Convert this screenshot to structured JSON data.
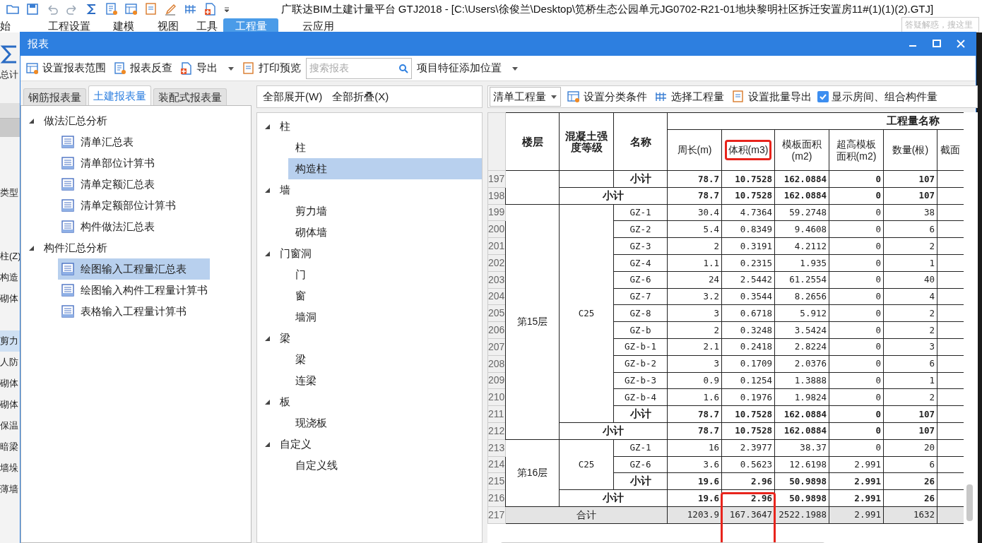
{
  "app": {
    "title": "广联达BIM土建计量平台 GTJ2018 - [C:\\Users\\徐俊兰\\Desktop\\笕桥生态公园单元JG0702-R21-01地块黎明社区拆迁安置房11#(1)(1)(2).GTJ]",
    "menu": [
      {
        "label": "始",
        "selected": false
      },
      {
        "label": "工程设置",
        "selected": false
      },
      {
        "label": "建模",
        "selected": false
      },
      {
        "label": "视图",
        "selected": false
      },
      {
        "label": "工具",
        "selected": false
      },
      {
        "label": "工程量",
        "selected": true
      },
      {
        "label": "云应用",
        "selected": false
      }
    ],
    "help_placeholder": "答疑解惑，搜这里",
    "side_label": "总计",
    "side_groups": [
      [
        {
          "label": "类型",
          "selected": false
        }
      ],
      [
        {
          "label": "柱(Z)",
          "selected": false
        },
        {
          "label": "构造",
          "selected": false
        },
        {
          "label": "砌体",
          "selected": false
        }
      ],
      [
        {
          "label": "剪力",
          "selected": true
        },
        {
          "label": "人防",
          "selected": false
        },
        {
          "label": "砌体",
          "selected": false
        },
        {
          "label": "砌体",
          "selected": false
        },
        {
          "label": "保温",
          "selected": false
        },
        {
          "label": "暗梁",
          "selected": false
        },
        {
          "label": "墙垛",
          "selected": false
        },
        {
          "label": "薄墙",
          "selected": false
        }
      ]
    ]
  },
  "dialog": {
    "title": "报表",
    "toolbar": [
      {
        "kind": "button",
        "label": "设置报表范围"
      },
      {
        "kind": "button",
        "label": "报表反查"
      },
      {
        "kind": "menu",
        "label": "导出"
      },
      {
        "kind": "button",
        "label": "打印预览"
      },
      {
        "kind": "search",
        "placeholder": "搜索报表"
      },
      {
        "kind": "menu",
        "label": "项目特征添加位置"
      }
    ],
    "report_tabs": [
      {
        "label": "钢筋报表量",
        "selected": false
      },
      {
        "label": "土建报表量",
        "selected": true
      },
      {
        "label": "装配式报表量",
        "selected": false
      }
    ],
    "report_tree": [
      {
        "label": "做法汇总分析",
        "expanded": true,
        "children": [
          {
            "label": "清单汇总表",
            "selected": false
          },
          {
            "label": "清单部位计算书",
            "selected": false
          },
          {
            "label": "清单定额汇总表",
            "selected": false
          },
          {
            "label": "清单定额部位计算书",
            "selected": false
          },
          {
            "label": "构件做法汇总表",
            "selected": false
          }
        ]
      },
      {
        "label": "构件汇总分析",
        "expanded": true,
        "children": [
          {
            "label": "绘图输入工程量汇总表",
            "selected": true
          },
          {
            "label": "绘图输入构件工程量计算书",
            "selected": false
          },
          {
            "label": "表格输入工程量计算书",
            "selected": false
          }
        ]
      }
    ],
    "component_actions": [
      "全部展开(W)",
      "全部折叠(X)"
    ],
    "component_tree": [
      {
        "label": "柱",
        "expanded": true,
        "children": [
          {
            "label": "柱",
            "selected": false
          },
          {
            "label": "构造柱",
            "selected": true
          }
        ]
      },
      {
        "label": "墙",
        "expanded": true,
        "children": [
          {
            "label": "剪力墙",
            "selected": false
          },
          {
            "label": "砌体墙",
            "selected": false
          }
        ]
      },
      {
        "label": "门窗洞",
        "expanded": true,
        "children": [
          {
            "label": "门",
            "selected": false
          },
          {
            "label": "窗",
            "selected": false
          },
          {
            "label": "墙洞",
            "selected": false
          }
        ]
      },
      {
        "label": "梁",
        "expanded": true,
        "children": [
          {
            "label": "梁",
            "selected": false
          },
          {
            "label": "连梁",
            "selected": false
          }
        ]
      },
      {
        "label": "板",
        "expanded": true,
        "children": [
          {
            "label": "现浇板",
            "selected": false
          }
        ]
      },
      {
        "label": "自定义",
        "expanded": true,
        "children": [
          {
            "label": "自定义线",
            "selected": false
          }
        ]
      }
    ],
    "table_toolbar": {
      "dropdown": "清单工程量",
      "buttons": [
        {
          "label": "设置分类条件"
        },
        {
          "label": "选择工程量"
        },
        {
          "label": "设置批量导出"
        }
      ],
      "checkbox": {
        "label": "显示房间、组合构件量",
        "checked": true
      }
    },
    "table": {
      "key_columns": [
        "楼层",
        "混凝土强度等级",
        "名称"
      ],
      "group_header": "工程量名称",
      "columns": [
        {
          "label": "周长(m)",
          "highlighted": false
        },
        {
          "label": "体积(m3)",
          "highlighted": true
        },
        {
          "label": "模板面积(m2)",
          "highlighted": false
        },
        {
          "label": "超高模板面积(m2)",
          "highlighted": false
        },
        {
          "label": "数量(根)",
          "highlighted": false
        },
        {
          "label": "截面",
          "highlighted": false
        }
      ],
      "floors": [
        {
          "grades": [
            {
              "items": [
                {
                  "num": "197",
                  "kind": "subtotal",
                  "name": "小计",
                  "values": [
                    "78.7",
                    "10.7528",
                    "162.0884",
                    "0",
                    "107"
                  ]
                }
              ]
            }
          ],
          "subtotal": {
            "num": "198",
            "label": "小计",
            "values": [
              "78.7",
              "10.7528",
              "162.0884",
              "0",
              "107"
            ]
          }
        },
        {
          "floor": "第15层",
          "grades": [
            {
              "grade": "C25",
              "items": [
                {
                  "num": "199",
                  "kind": "item",
                  "name": "GZ-1",
                  "values": [
                    "30.4",
                    "4.7364",
                    "59.2748",
                    "0",
                    "38"
                  ]
                },
                {
                  "num": "200",
                  "kind": "item",
                  "name": "GZ-2",
                  "values": [
                    "5.4",
                    "0.8349",
                    "9.4608",
                    "0",
                    "6"
                  ]
                },
                {
                  "num": "201",
                  "kind": "item",
                  "name": "GZ-3",
                  "values": [
                    "2",
                    "0.3191",
                    "4.2112",
                    "0",
                    "2"
                  ]
                },
                {
                  "num": "202",
                  "kind": "item",
                  "name": "GZ-4",
                  "values": [
                    "1.1",
                    "0.2315",
                    "1.935",
                    "0",
                    "1"
                  ]
                },
                {
                  "num": "203",
                  "kind": "item",
                  "name": "GZ-6",
                  "values": [
                    "24",
                    "2.5442",
                    "61.2554",
                    "0",
                    "40"
                  ]
                },
                {
                  "num": "204",
                  "kind": "item",
                  "name": "GZ-7",
                  "values": [
                    "3.2",
                    "0.3544",
                    "8.2656",
                    "0",
                    "4"
                  ]
                },
                {
                  "num": "205",
                  "kind": "item",
                  "name": "GZ-8",
                  "values": [
                    "3",
                    "0.6718",
                    "5.912",
                    "0",
                    "2"
                  ]
                },
                {
                  "num": "206",
                  "kind": "item",
                  "name": "GZ-b",
                  "values": [
                    "2",
                    "0.3248",
                    "3.5424",
                    "0",
                    "2"
                  ]
                },
                {
                  "num": "207",
                  "kind": "item",
                  "name": "GZ-b-1",
                  "values": [
                    "2.1",
                    "0.2418",
                    "2.8224",
                    "0",
                    "3"
                  ]
                },
                {
                  "num": "208",
                  "kind": "item",
                  "name": "GZ-b-2",
                  "values": [
                    "3",
                    "0.1709",
                    "2.0376",
                    "0",
                    "6"
                  ]
                },
                {
                  "num": "209",
                  "kind": "item",
                  "name": "GZ-b-3",
                  "values": [
                    "0.9",
                    "0.1254",
                    "1.3888",
                    "0",
                    "1"
                  ]
                },
                {
                  "num": "210",
                  "kind": "item",
                  "name": "GZ-b-4",
                  "values": [
                    "1.6",
                    "0.1976",
                    "1.9824",
                    "0",
                    "2"
                  ]
                },
                {
                  "num": "211",
                  "kind": "subtotal",
                  "name": "小计",
                  "values": [
                    "78.7",
                    "10.7528",
                    "162.0884",
                    "0",
                    "107"
                  ]
                }
              ]
            }
          ],
          "subtotal": {
            "num": "212",
            "label": "小计",
            "values": [
              "78.7",
              "10.7528",
              "162.0884",
              "0",
              "107"
            ]
          }
        },
        {
          "floor": "第16层",
          "grades": [
            {
              "grade": "C25",
              "items": [
                {
                  "num": "213",
                  "kind": "item",
                  "name": "GZ-1",
                  "values": [
                    "16",
                    "2.3977",
                    "38.37",
                    "0",
                    "20"
                  ]
                },
                {
                  "num": "214",
                  "kind": "item",
                  "name": "GZ-6",
                  "values": [
                    "3.6",
                    "0.5623",
                    "12.6198",
                    "2.991",
                    "6"
                  ]
                },
                {
                  "num": "215",
                  "kind": "subtotal",
                  "name": "小计",
                  "values": [
                    "19.6",
                    "2.96",
                    "50.9898",
                    "2.991",
                    "26"
                  ]
                }
              ]
            }
          ],
          "subtotal": {
            "num": "216",
            "label": "小计",
            "values": [
              "19.6",
              "2.96",
              "50.9898",
              "2.991",
              "26"
            ]
          }
        }
      ],
      "total": {
        "num": "217",
        "label": "合计",
        "values": [
          "1203.9",
          "167.3647",
          "2522.1988",
          "2.991",
          "1632"
        ]
      }
    }
  }
}
